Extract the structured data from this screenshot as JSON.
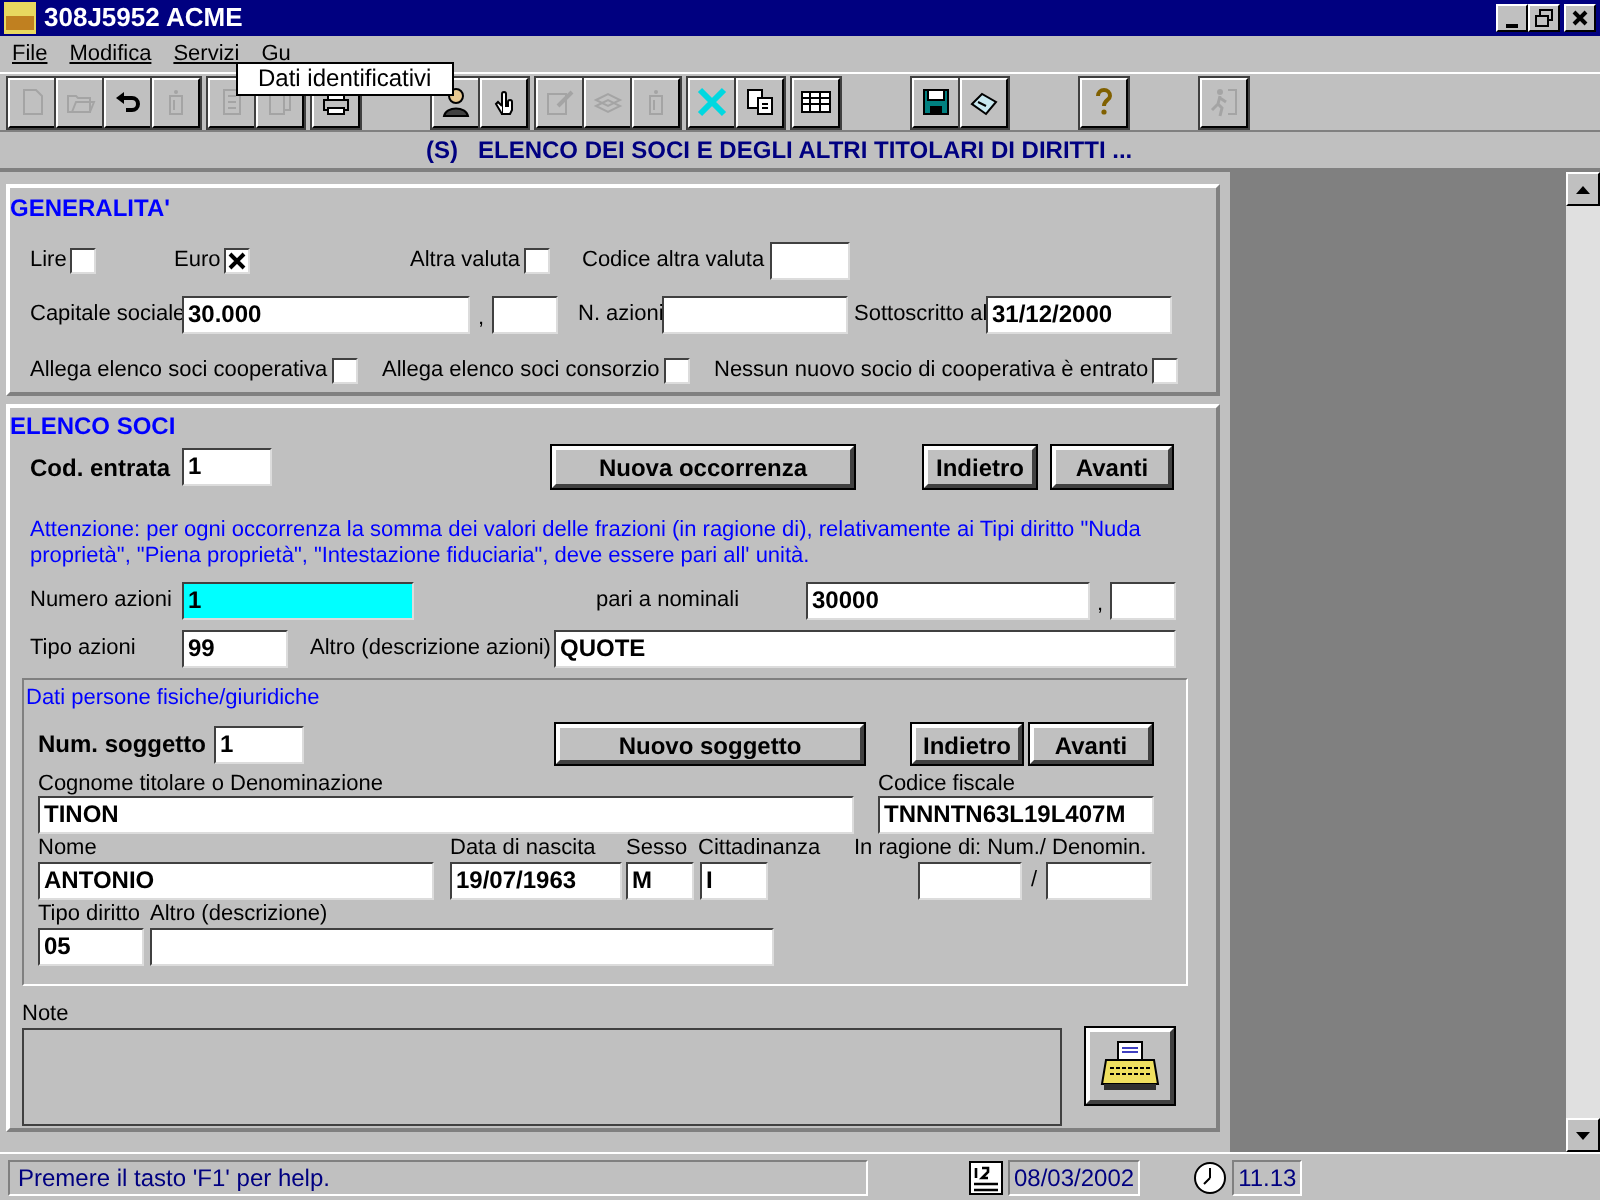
{
  "window": {
    "title": "308J5952 ACME"
  },
  "menu": [
    {
      "label": "File"
    },
    {
      "label": "Modifica"
    },
    {
      "label": "Servizi"
    },
    {
      "label": "Gu"
    }
  ],
  "tooltip": "Dati identificativi",
  "toolbar": [
    [
      [
        {
          "kind": "page",
          "disabled": true
        },
        {
          "kind": "folder",
          "disabled": true
        },
        {
          "kind": "undo",
          "disabled": false
        },
        {
          "kind": "info",
          "disabled": true
        }
      ],
      [
        {
          "kind": "document",
          "disabled": true
        },
        {
          "kind": "documents",
          "disabled": true
        }
      ],
      [
        {
          "kind": "printer",
          "disabled": false
        }
      ]
    ],
    [
      [
        {
          "kind": "person",
          "disabled": false
        },
        {
          "kind": "hand",
          "disabled": false
        }
      ],
      [
        {
          "kind": "edit",
          "disabled": true
        },
        {
          "kind": "stack",
          "disabled": true
        },
        {
          "kind": "info",
          "disabled": true
        }
      ],
      [
        {
          "kind": "cross",
          "disabled": false
        },
        {
          "kind": "copy",
          "disabled": false
        }
      ],
      [
        {
          "kind": "grid",
          "disabled": false
        }
      ]
    ],
    [
      [
        {
          "kind": "disk",
          "disabled": false
        },
        {
          "kind": "fax",
          "disabled": false
        }
      ]
    ],
    [
      [
        {
          "kind": "help",
          "disabled": false
        }
      ]
    ],
    [
      [
        {
          "kind": "exit",
          "disabled": true
        }
      ]
    ]
  ],
  "header": "(S)   ELENCO DEI SOCI E DEGLI ALTRI TITOLARI DI DIRITTI ...",
  "generalita": {
    "title": "GENERALITA'",
    "currencies": [
      {
        "label": "Lire",
        "checked": false
      },
      {
        "label": "Euro",
        "checked": true
      },
      {
        "label": "Altra valuta",
        "checked": false
      }
    ],
    "codice_altra_valuta": {
      "label": "Codice altra valuta"
    },
    "capitale_sociale": {
      "label": "Capitale sociale",
      "value": "30.000",
      "separator": ","
    },
    "n_azioni": {
      "label": "N. azioni"
    },
    "sottoscritto_al": {
      "label": "Sottoscritto al",
      "value": "31/12/2000"
    },
    "options": [
      {
        "label": "Allega elenco soci cooperativa",
        "checked": false
      },
      {
        "label": "Allega elenco soci consorzio",
        "checked": false
      },
      {
        "label": "Nessun nuovo socio di cooperativa è entrato",
        "checked": false
      }
    ]
  },
  "elenco_soci": {
    "title": "ELENCO SOCI",
    "cod_entrata": {
      "label": "Cod. entrata",
      "value": "1"
    },
    "buttons": [
      "Nuova occorrenza",
      "Indietro",
      "Avanti"
    ],
    "notice": "Attenzione: per ogni occorrenza la somma dei valori delle frazioni (in ragione di), relativamente ai Tipi diritto \"Nuda proprietà\", \"Piena proprietà\", \"Intestazione fiduciaria\", deve essere pari all' unità.",
    "numero_azioni": {
      "label": "Numero azioni",
      "value": "1"
    },
    "pari_a_nominali": {
      "label": "pari a nominali",
      "value": "30000",
      "separator": ","
    },
    "tipo_azioni": {
      "label": "Tipo azioni",
      "value": "99"
    },
    "altro_azioni": {
      "label": "Altro (descrizione azioni)",
      "value": "QUOTE"
    },
    "persone": {
      "title": "Dati persone fisiche/giuridiche",
      "num_soggetto": {
        "label": "Num. soggetto",
        "value": "1"
      },
      "buttons": [
        "Nuovo soggetto",
        "Indietro",
        "Avanti"
      ],
      "cognome": {
        "label": "Cognome titolare o Denominazione",
        "value": "TINON"
      },
      "codice_fiscale": {
        "label": "Codice fiscale",
        "value": "TNNNTN63L19L407M"
      },
      "nome": {
        "label": "Nome",
        "value": "ANTONIO"
      },
      "data_nascita": {
        "label": "Data di nascita",
        "value": "19/07/1963"
      },
      "sesso": {
        "label": "Sesso",
        "value": "M"
      },
      "cittadinanza": {
        "label": "Cittadinanza",
        "value": "I"
      },
      "in_ragione_di": {
        "label": "In ragione di: Num./ Denomin.",
        "separator": "/"
      },
      "tipo_diritto": {
        "label": "Tipo diritto",
        "value": "05"
      },
      "altro": {
        "label": "Altro (descrizione)"
      }
    },
    "note": {
      "label": "Note"
    }
  },
  "status_bar": {
    "help": "Premere il tasto 'F1' per help.",
    "date": "08/03/2002",
    "time": "11.13"
  }
}
